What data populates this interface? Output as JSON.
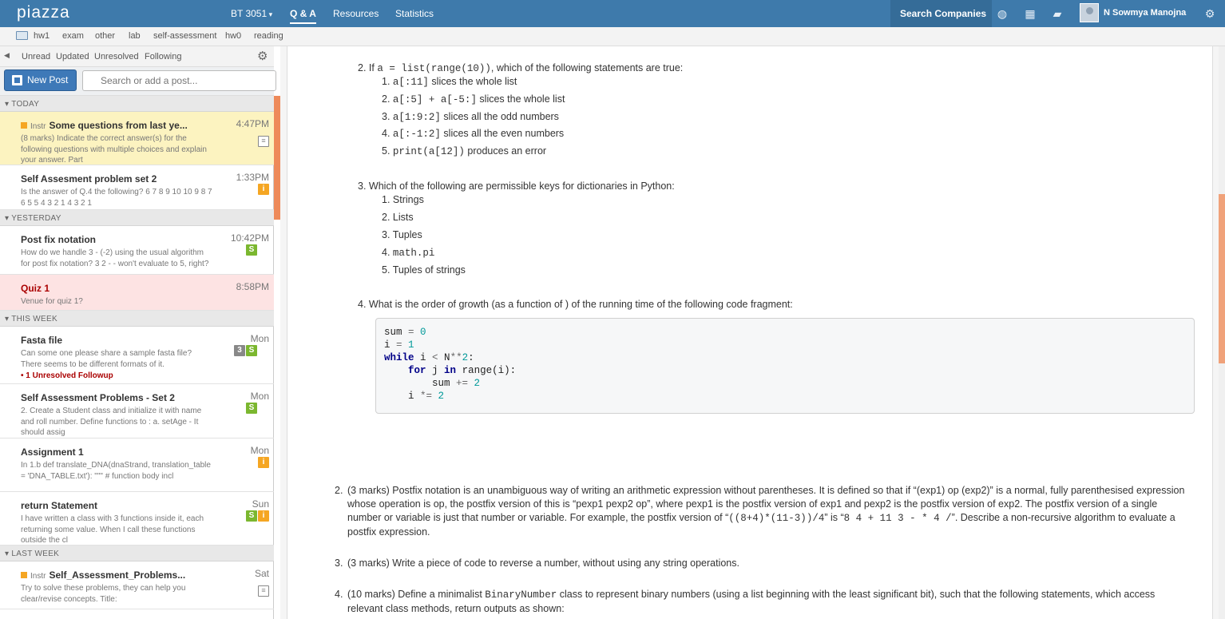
{
  "topbar": {
    "logo": "piazza",
    "course": "BT 3051",
    "tabs": [
      "Q & A",
      "Resources",
      "Statistics"
    ],
    "search_companies": "Search Companies",
    "username": "N Sowmya Manojna"
  },
  "folders": [
    "hw1",
    "exam",
    "other",
    "lab",
    "self-assessment",
    "hw0",
    "reading"
  ],
  "filters": [
    "Unread",
    "Updated",
    "Unresolved",
    "Following"
  ],
  "new_post": "New Post",
  "search_placeholder": "Search or add a post...",
  "groups": {
    "today": "▾ TODAY",
    "yesterday": "▾ YESTERDAY",
    "this_week": "▾ THIS WEEK",
    "last_week": "▾ LAST WEEK"
  },
  "posts": [
    {
      "tag": "Instr",
      "title": "Some questions from last ye...",
      "snippet": "(8 marks) Indicate the correct answer(s) for the following questions with multiple choices and explain your answer. Part",
      "time": "4:47PM",
      "icons": [
        "note"
      ]
    },
    {
      "title": "Self Assesment problem set 2",
      "snippet": "Is the answer of Q.4 the following? 6 7 8 9 10 10 9 8 7 6 5 5 4 3 2 1 4 3 2 1",
      "time": "1:33PM",
      "icons": [
        "i"
      ]
    },
    {
      "title": "Post fix notation",
      "snippet": "How do we handle 3 - (-2) using the usual algorithm for post fix notation? 3 2 - - won't evaluate to 5, right?",
      "time": "10:42PM",
      "icons": [
        "s"
      ]
    },
    {
      "title": "Quiz 1",
      "snippet": "Venue for quiz 1?",
      "time": "8:58PM",
      "icons": []
    },
    {
      "title": "Fasta file",
      "snippet": "Can some one please share a sample fasta file? There seems to be different formats of it.",
      "time": "Mon",
      "icons": [
        "3",
        "s"
      ],
      "followup": "• 1 Unresolved Followup"
    },
    {
      "title": "Self Assessment Problems - Set 2",
      "snippet": "2. Create a Student class and initialize it with name and roll number. Define functions to : a. setAge - It should assig",
      "time": "Mon",
      "icons": [
        "s"
      ]
    },
    {
      "title": "Assignment 1",
      "snippet": "In 1.b def translate_DNA(dnaStrand, translation_table = 'DNA_TABLE.txt'): \"\"\" # function body incl",
      "time": "Mon",
      "icons": [
        "i"
      ]
    },
    {
      "title": "return Statement",
      "snippet": "I have written a class with 3 functions inside it, each returning some value. When I call these functions outside the cl",
      "time": "Sun",
      "icons": [
        "s",
        "i"
      ]
    },
    {
      "tag": "Instr",
      "title": "Self_Assessment_Problems...",
      "snippet": "Try to solve these problems, they can help you clear/revise concepts. Title:",
      "time": "Sat",
      "icons": [
        "note"
      ]
    }
  ],
  "content": {
    "q2": {
      "num": "2.",
      "pre": "If ",
      "code1": "a = list(range(10))",
      "post": ", which of the following statements are true:",
      "items": [
        {
          "n": "1.",
          "code": "a[:11]",
          "text": " slices the whole list"
        },
        {
          "n": "2.",
          "code": "a[:5] + a[-5:]",
          "text": " slices the whole list"
        },
        {
          "n": "3.",
          "code": "a[1:9:2]",
          "text": " slices all the odd numbers"
        },
        {
          "n": "4.",
          "code": "a[:-1:2]",
          "text": " slices all the even numbers"
        },
        {
          "n": "5.",
          "code": "print(a[12])",
          "text": " produces an error"
        }
      ]
    },
    "q3": {
      "num": "3.",
      "text": "Which of the following are permissible keys for dictionaries in Python:",
      "items": [
        {
          "n": "1.",
          "text": "Strings"
        },
        {
          "n": "2.",
          "text": "Lists"
        },
        {
          "n": "3.",
          "text": "Tuples"
        },
        {
          "n": "4.",
          "code": "math.pi"
        },
        {
          "n": "5.",
          "text": "Tuples of strings"
        }
      ]
    },
    "q4": {
      "num": "4.",
      "text": "What is the order of growth (as a function of ) of the running time of the following code fragment:"
    },
    "code_lines": [
      "sum = 0",
      "i = 1",
      "while i < N**2:",
      "    for j in range(i):",
      "        sum += 2",
      "    i *= 2"
    ],
    "p2": {
      "num": "2.",
      "text": "(3 marks) Postfix notation is an unambiguous way of writing an arithmetic expression without parentheses. It is defined so that if “(exp1) op (exp2)” is a normal, fully parenthesised expression whose operation is op, the postfix version of this is “pexp1 pexp2 op”, where pexp1 is the postfix version of exp1 and pexp2 is the postfix version of exp2. The postfix version of a single number or variable is just that number or variable. For example, the postfix version of “",
      "code1": "((8+4)*(11-3))/4",
      "mid": "” is “",
      "code2": "8 4 + 11 3 - * 4 /",
      "end": "”. Describe a non-recursive algorithm to evaluate a postfix expression."
    },
    "p3": {
      "num": "3.",
      "text": "(3 marks) Write a piece of code to reverse a number, without using any string operations."
    },
    "p4": {
      "num": "4.",
      "pre": "(10 marks) Define a minimalist ",
      "code": "BinaryNumber",
      "post": " class to represent binary numbers (using a list beginning with the least significant bit), such that the following statements, which access relevant class methods, return outputs as shown:"
    }
  }
}
